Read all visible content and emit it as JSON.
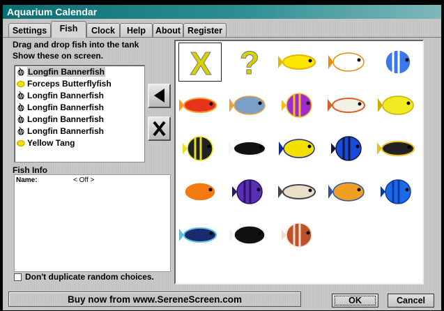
{
  "window": {
    "title": "Aquarium Calendar"
  },
  "tabs": [
    {
      "label": "Settings",
      "active": false
    },
    {
      "label": "Fish",
      "active": true
    },
    {
      "label": "Clock",
      "active": false
    },
    {
      "label": "Help",
      "active": false
    },
    {
      "label": "About",
      "active": false
    },
    {
      "label": "Register",
      "active": false
    }
  ],
  "instructions": {
    "line1": "Drag and drop fish into the tank",
    "line2": "Show these on screen."
  },
  "fish_list": [
    {
      "label": "Longfin Bannerfish",
      "icon": "bannerfish-icon",
      "selected": true
    },
    {
      "label": "Forceps Butterflyfish",
      "icon": "butterflyfish-icon",
      "selected": false
    },
    {
      "label": "Longfin Bannerfish",
      "icon": "bannerfish-icon",
      "selected": false
    },
    {
      "label": "Longfin Bannerfish",
      "icon": "bannerfish-icon",
      "selected": false
    },
    {
      "label": "Longfin Bannerfish",
      "icon": "bannerfish-icon",
      "selected": false
    },
    {
      "label": "Longfin Bannerfish",
      "icon": "bannerfish-icon",
      "selected": false
    },
    {
      "label": "Yellow Tang",
      "icon": "tang-icon",
      "selected": false
    }
  ],
  "fish_info": {
    "heading": "Fish Info",
    "name_key": "Name:",
    "name_value": "< Off >"
  },
  "random_option": {
    "label": "Don't duplicate random choices.",
    "checked": false
  },
  "side_buttons": {
    "add": "left-arrow-icon",
    "remove": "x-icon"
  },
  "palette": {
    "title_bar": "#0c6e73",
    "cells": [
      {
        "kind": "none",
        "glyph": "X",
        "color": "#d9d000"
      },
      {
        "kind": "random",
        "glyph": "?",
        "color": "#d9d000"
      },
      {
        "kind": "fish",
        "icon": "yellow-fish-icon",
        "colors": [
          "#ffe600",
          "#e0b800"
        ]
      },
      {
        "kind": "fish",
        "icon": "butterflyfish-icon",
        "colors": [
          "#ffffff",
          "#f08a00"
        ]
      },
      {
        "kind": "fish",
        "icon": "blue-tang-icon",
        "colors": [
          "#3a78e8",
          "#ffffff"
        ]
      },
      {
        "kind": "fish",
        "icon": "red-fish-icon",
        "colors": [
          "#e8331a",
          "#ff9a20"
        ]
      },
      {
        "kind": "fish",
        "icon": "angelfish-icon",
        "colors": [
          "#7ba0c8",
          "#e8a040"
        ]
      },
      {
        "kind": "fish",
        "icon": "purple-fish-icon",
        "colors": [
          "#a12bd0",
          "#f0c020"
        ]
      },
      {
        "kind": "fish",
        "icon": "striped-fish-icon",
        "colors": [
          "#f3f0e6",
          "#d8612a"
        ]
      },
      {
        "kind": "fish",
        "icon": "yellow-butterflyfish-icon",
        "colors": [
          "#f2ea20",
          "#c8b000"
        ]
      },
      {
        "kind": "fish",
        "icon": "french-angelfish-icon",
        "colors": [
          "#222222",
          "#e8e020"
        ]
      },
      {
        "kind": "fish",
        "icon": "moorish-idol-icon",
        "colors": [
          "#111111",
          "#f5f5f5"
        ]
      },
      {
        "kind": "fish",
        "icon": "yellow-wrasse-icon",
        "colors": [
          "#f2e000",
          "#1a2a8a"
        ]
      },
      {
        "kind": "fish",
        "icon": "regal-tang-icon",
        "colors": [
          "#1a4ad8",
          "#101840"
        ]
      },
      {
        "kind": "fish",
        "icon": "triggerfish-icon",
        "colors": [
          "#222222",
          "#e8c020"
        ]
      },
      {
        "kind": "fish",
        "icon": "clownfish-icon",
        "colors": [
          "#f27a10",
          "#ffffff"
        ]
      },
      {
        "kind": "fish",
        "icon": "purple-tang-icon",
        "colors": [
          "#5a30b0",
          "#2a1070"
        ]
      },
      {
        "kind": "fish",
        "icon": "picasso-triggerfish-icon",
        "colors": [
          "#e8e0c8",
          "#444444"
        ]
      },
      {
        "kind": "fish",
        "icon": "regal-angelfish-icon",
        "colors": [
          "#f0a020",
          "#3050a0"
        ]
      },
      {
        "kind": "fish",
        "icon": "blue-damsel-icon",
        "colors": [
          "#1a6ae8",
          "#0a3aa0"
        ]
      },
      {
        "kind": "fish",
        "icon": "koran-angelfish-icon",
        "colors": [
          "#1a2a6a",
          "#5ac0e8"
        ]
      },
      {
        "kind": "fish",
        "icon": "black-white-fish-icon",
        "colors": [
          "#111111",
          "#f2f2f2"
        ]
      },
      {
        "kind": "fish",
        "icon": "lionfish-icon",
        "colors": [
          "#c0502a",
          "#f0e0d0"
        ]
      }
    ]
  },
  "footer": {
    "buy_text": "Buy now from www.SereneScreen.com",
    "ok_label": "OK",
    "cancel_label": "Cancel"
  }
}
